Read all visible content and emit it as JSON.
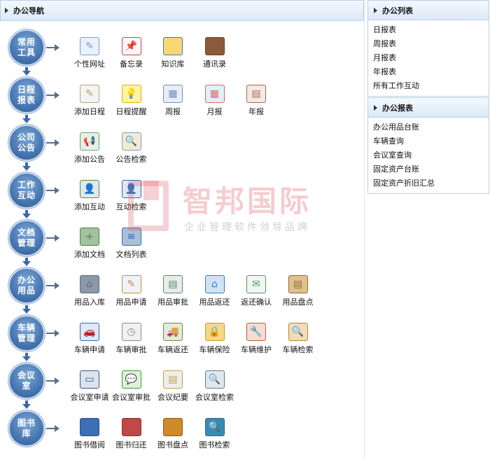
{
  "left_panel": {
    "title": "办公导航"
  },
  "rows": [
    {
      "name": "常用工具",
      "items": [
        "个性网址",
        "备忘录",
        "知识库",
        "通讯录"
      ]
    },
    {
      "name": "日程报表",
      "items": [
        "添加日程",
        "日程提醒",
        "周报",
        "月报",
        "年报"
      ]
    },
    {
      "name": "公司公告",
      "items": [
        "添加公告",
        "公告检索"
      ]
    },
    {
      "name": "工作互动",
      "items": [
        "添加互动",
        "互动检索"
      ]
    },
    {
      "name": "文档管理",
      "items": [
        "添加文档",
        "文档列表"
      ]
    },
    {
      "name": "办公用品",
      "items": [
        "用品入库",
        "用品申请",
        "用品审批",
        "用品返还",
        "返还确认",
        "用品盘点"
      ]
    },
    {
      "name": "车辆管理",
      "items": [
        "车辆申请",
        "车辆审批",
        "车辆返还",
        "车辆保险",
        "车辆维护",
        "车辆检索"
      ]
    },
    {
      "name": "会议室",
      "items": [
        "会议室申请",
        "会议室审批",
        "会议纪要",
        "会议室检索"
      ]
    },
    {
      "name": "图书库",
      "items": [
        "图书借阅",
        "图书归还",
        "图书盘点",
        "图书检索"
      ]
    }
  ],
  "right_panels": [
    {
      "title": "办公列表",
      "items": [
        "日报表",
        "周报表",
        "月报表",
        "年报表",
        "所有工作互动"
      ]
    },
    {
      "title": "办公报表",
      "items": [
        "办公用品台账",
        "车辆查询",
        "会议室查询",
        "固定资产台账",
        "固定资产折旧汇总"
      ]
    }
  ],
  "watermark": {
    "main": "智邦国际",
    "sub": "企业管理软件领导品牌"
  },
  "icons": [
    [
      "pencil-note-icon",
      "memo-pin-icon",
      "folder-icon",
      "address-book-icon"
    ],
    [
      "edit-schedule-icon",
      "lightbulb-icon",
      "week-calendar-icon",
      "month-calendar-icon",
      "year-report-icon"
    ],
    [
      "megaphone-icon",
      "document-search-icon"
    ],
    [
      "user-add-icon",
      "user-search-icon"
    ],
    [
      "folder-add-icon",
      "folder-list-icon"
    ],
    [
      "warehouse-icon",
      "form-pen-icon",
      "approval-person-icon",
      "store-return-icon",
      "envelope-check-icon",
      "clipboard-icon"
    ],
    [
      "car-user-icon",
      "calendar-clock-icon",
      "truck-return-icon",
      "padlock-icon",
      "car-repair-icon",
      "car-search-icon"
    ],
    [
      "meeting-board-icon",
      "chat-bubbles-icon",
      "minutes-card-icon",
      "monitor-search-icon"
    ],
    [
      "book-blue-icon",
      "book-red-icon",
      "book-box-icon",
      "book-search-icon"
    ]
  ],
  "colors": {
    "accent": "#3b69a5",
    "header_bg": "#dce9f6",
    "border": "#b8cfe6"
  }
}
